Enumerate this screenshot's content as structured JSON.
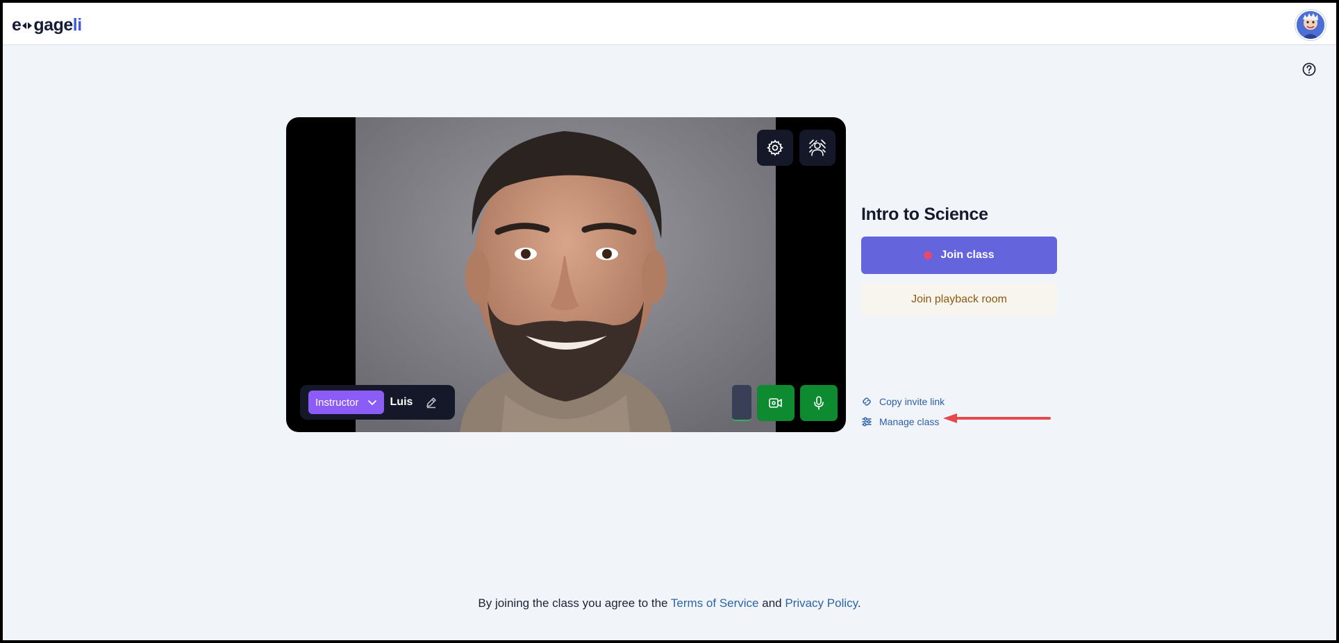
{
  "brand": {
    "logo_prefix": "e",
    "logo_middle": "gage",
    "logo_suffix": "li"
  },
  "header": {
    "avatar_icon": "user-avatar-icon",
    "help_icon": "help-circle-icon"
  },
  "preview": {
    "settings_icon": "gear-icon",
    "background_effects_icon": "background-blur-icon",
    "role_label": "Instructor",
    "user_name": "Luis",
    "edit_icon": "pencil-icon",
    "camera_icon": "video-camera-icon",
    "mic_icon": "microphone-icon"
  },
  "class": {
    "title": "Intro to Science",
    "join_label": "Join class",
    "playback_label": "Join playback room",
    "copy_invite_label": "Copy invite link",
    "manage_label": "Manage class"
  },
  "footer": {
    "prefix": "By joining the class you agree to the ",
    "terms_label": "Terms of Service",
    "middle": " and ",
    "privacy_label": "Privacy Policy",
    "suffix": "."
  },
  "colors": {
    "join_button": "#6464dc",
    "role_badge": "#8b5cf6",
    "media_buttons": "#0e8a30",
    "link": "#2b5ea9",
    "annotation_arrow": "#e5484d"
  }
}
